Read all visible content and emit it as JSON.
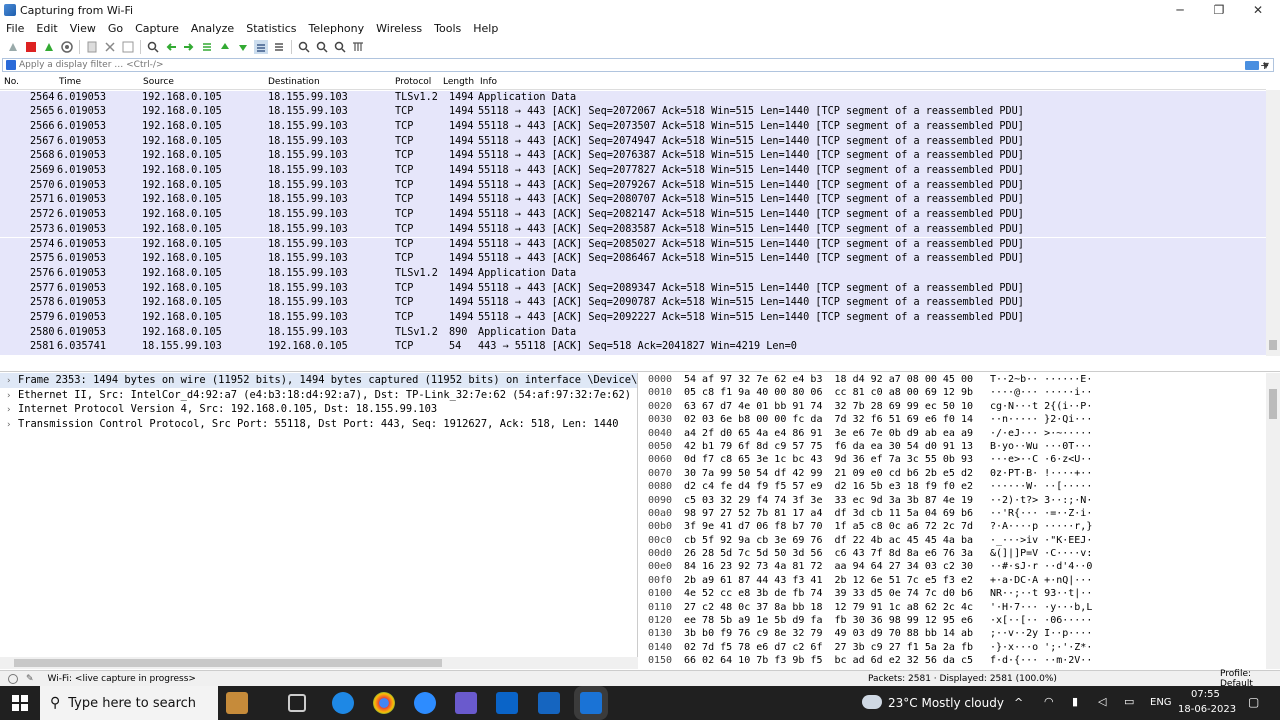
{
  "window": {
    "title": "Capturing from Wi-Fi",
    "minimize": "─",
    "maximize": "❐",
    "close": "✕"
  },
  "menu": [
    "File",
    "Edit",
    "View",
    "Go",
    "Capture",
    "Analyze",
    "Statistics",
    "Telephony",
    "Wireless",
    "Tools",
    "Help"
  ],
  "filter": {
    "placeholder": "Apply a display filter … <Ctrl-/>"
  },
  "packet_list": {
    "columns": [
      "No.",
      "Time",
      "Source",
      "Destination",
      "Protocol",
      "Length",
      "Info"
    ],
    "rows": [
      {
        "no": "2564",
        "time": "6.019053",
        "src": "192.168.0.105",
        "dst": "18.155.99.103",
        "proto": "TLSv1.2",
        "len": "1494",
        "info": "Application Data"
      },
      {
        "no": "2565",
        "time": "6.019053",
        "src": "192.168.0.105",
        "dst": "18.155.99.103",
        "proto": "TCP",
        "len": "1494",
        "info": "55118 → 443 [ACK] Seq=2072067 Ack=518 Win=515 Len=1440 [TCP segment of a reassembled PDU]"
      },
      {
        "no": "2566",
        "time": "6.019053",
        "src": "192.168.0.105",
        "dst": "18.155.99.103",
        "proto": "TCP",
        "len": "1494",
        "info": "55118 → 443 [ACK] Seq=2073507 Ack=518 Win=515 Len=1440 [TCP segment of a reassembled PDU]"
      },
      {
        "no": "2567",
        "time": "6.019053",
        "src": "192.168.0.105",
        "dst": "18.155.99.103",
        "proto": "TCP",
        "len": "1494",
        "info": "55118 → 443 [ACK] Seq=2074947 Ack=518 Win=515 Len=1440 [TCP segment of a reassembled PDU]"
      },
      {
        "no": "2568",
        "time": "6.019053",
        "src": "192.168.0.105",
        "dst": "18.155.99.103",
        "proto": "TCP",
        "len": "1494",
        "info": "55118 → 443 [ACK] Seq=2076387 Ack=518 Win=515 Len=1440 [TCP segment of a reassembled PDU]"
      },
      {
        "no": "2569",
        "time": "6.019053",
        "src": "192.168.0.105",
        "dst": "18.155.99.103",
        "proto": "TCP",
        "len": "1494",
        "info": "55118 → 443 [ACK] Seq=2077827 Ack=518 Win=515 Len=1440 [TCP segment of a reassembled PDU]"
      },
      {
        "no": "2570",
        "time": "6.019053",
        "src": "192.168.0.105",
        "dst": "18.155.99.103",
        "proto": "TCP",
        "len": "1494",
        "info": "55118 → 443 [ACK] Seq=2079267 Ack=518 Win=515 Len=1440 [TCP segment of a reassembled PDU]"
      },
      {
        "no": "2571",
        "time": "6.019053",
        "src": "192.168.0.105",
        "dst": "18.155.99.103",
        "proto": "TCP",
        "len": "1494",
        "info": "55118 → 443 [ACK] Seq=2080707 Ack=518 Win=515 Len=1440 [TCP segment of a reassembled PDU]"
      },
      {
        "no": "2572",
        "time": "6.019053",
        "src": "192.168.0.105",
        "dst": "18.155.99.103",
        "proto": "TCP",
        "len": "1494",
        "info": "55118 → 443 [ACK] Seq=2082147 Ack=518 Win=515 Len=1440 [TCP segment of a reassembled PDU]"
      },
      {
        "no": "2573",
        "time": "6.019053",
        "src": "192.168.0.105",
        "dst": "18.155.99.103",
        "proto": "TCP",
        "len": "1494",
        "info": "55118 → 443 [ACK] Seq=2083587 Ack=518 Win=515 Len=1440 [TCP segment of a reassembled PDU]"
      },
      {
        "no": "2574",
        "time": "6.019053",
        "src": "192.168.0.105",
        "dst": "18.155.99.103",
        "proto": "TCP",
        "len": "1494",
        "info": "55118 → 443 [ACK] Seq=2085027 Ack=518 Win=515 Len=1440 [TCP segment of a reassembled PDU]"
      },
      {
        "no": "2575",
        "time": "6.019053",
        "src": "192.168.0.105",
        "dst": "18.155.99.103",
        "proto": "TCP",
        "len": "1494",
        "info": "55118 → 443 [ACK] Seq=2086467 Ack=518 Win=515 Len=1440 [TCP segment of a reassembled PDU]"
      },
      {
        "no": "2576",
        "time": "6.019053",
        "src": "192.168.0.105",
        "dst": "18.155.99.103",
        "proto": "TLSv1.2",
        "len": "1494",
        "info": "Application Data"
      },
      {
        "no": "2577",
        "time": "6.019053",
        "src": "192.168.0.105",
        "dst": "18.155.99.103",
        "proto": "TCP",
        "len": "1494",
        "info": "55118 → 443 [ACK] Seq=2089347 Ack=518 Win=515 Len=1440 [TCP segment of a reassembled PDU]"
      },
      {
        "no": "2578",
        "time": "6.019053",
        "src": "192.168.0.105",
        "dst": "18.155.99.103",
        "proto": "TCP",
        "len": "1494",
        "info": "55118 → 443 [ACK] Seq=2090787 Ack=518 Win=515 Len=1440 [TCP segment of a reassembled PDU]"
      },
      {
        "no": "2579",
        "time": "6.019053",
        "src": "192.168.0.105",
        "dst": "18.155.99.103",
        "proto": "TCP",
        "len": "1494",
        "info": "55118 → 443 [ACK] Seq=2092227 Ack=518 Win=515 Len=1440 [TCP segment of a reassembled PDU]"
      },
      {
        "no": "2580",
        "time": "6.019053",
        "src": "192.168.0.105",
        "dst": "18.155.99.103",
        "proto": "TLSv1.2",
        "len": "890",
        "info": "Application Data"
      },
      {
        "no": "2581",
        "time": "6.035741",
        "src": "18.155.99.103",
        "dst": "192.168.0.105",
        "proto": "TCP",
        "len": "54",
        "info": "443 → 55118 [ACK] Seq=518 Ack=2041827 Win=4219 Len=0"
      }
    ]
  },
  "details": [
    "Frame 2353: 1494 bytes on wire (11952 bits), 1494 bytes captured (11952 bits) on interface \\Device\\NPF_",
    "Ethernet II, Src: IntelCor_d4:92:a7 (e4:b3:18:d4:92:a7), Dst: TP-Link_32:7e:62 (54:af:97:32:7e:62)",
    "Internet Protocol Version 4, Src: 192.168.0.105, Dst: 18.155.99.103",
    "Transmission Control Protocol, Src Port: 55118, Dst Port: 443, Seq: 1912627, Ack: 518, Len: 1440"
  ],
  "hex": [
    {
      "off": "0000",
      "bytes": "54 af 97 32 7e 62 e4 b3  18 d4 92 a7 08 00 45 00",
      "ascii": "T··2~b·· ······E·"
    },
    {
      "off": "0010",
      "bytes": "05 c8 f1 9a 40 00 80 06  cc 81 c0 a8 00 69 12 9b",
      "ascii": "····@··· ·····i··"
    },
    {
      "off": "0020",
      "bytes": "63 67 d7 4e 01 bb 91 74  32 7b 28 69 99 ec 50 10",
      "ascii": "cg·N···t 2{(i··P·"
    },
    {
      "off": "0030",
      "bytes": "02 03 6e b8 00 00 fc da  7d 32 f6 51 69 e6 f0 14",
      "ascii": "··n····· }2·Qi···"
    },
    {
      "off": "0040",
      "bytes": "a4 2f d0 65 4a e4 86 91  3e e6 7e 0b d9 ab ea a9",
      "ascii": "·/·eJ··· >·~·····"
    },
    {
      "off": "0050",
      "bytes": "42 b1 79 6f 8d c9 57 75  f6 da ea 30 54 d0 91 13",
      "ascii": "B·yo··Wu ···0T···"
    },
    {
      "off": "0060",
      "bytes": "0d f7 c8 65 3e 1c bc 43  9d 36 ef 7a 3c 55 0b 93",
      "ascii": "···e>··C ·6·z<U··"
    },
    {
      "off": "0070",
      "bytes": "30 7a 99 50 54 df 42 99  21 09 e0 cd b6 2b e5 d2",
      "ascii": "0z·PT·B· !····+··"
    },
    {
      "off": "0080",
      "bytes": "d2 c4 fe d4 f9 f5 57 e9  d2 16 5b e3 18 f9 f0 e2",
      "ascii": "······W· ··[·····"
    },
    {
      "off": "0090",
      "bytes": "c5 03 32 29 f4 74 3f 3e  33 ec 9d 3a 3b 87 4e 19",
      "ascii": "··2)·t?> 3··:;·N·"
    },
    {
      "off": "00a0",
      "bytes": "98 97 27 52 7b 81 17 a4  df 3d cb 11 5a 04 69 b6",
      "ascii": "··'R{··· ·=··Z·i·"
    },
    {
      "off": "00b0",
      "bytes": "3f 9e 41 d7 06 f8 b7 70  1f a5 c8 0c a6 72 2c 7d",
      "ascii": "?·A····p ·····r,}"
    },
    {
      "off": "00c0",
      "bytes": "cb 5f 92 9a cb 3e 69 76  df 22 4b ac 45 45 4a ba",
      "ascii": "·_···>iv ·\"K·EEJ·"
    },
    {
      "off": "00d0",
      "bytes": "26 28 5d 7c 5d 50 3d 56  c6 43 7f 8d 8a e6 76 3a",
      "ascii": "&(]|]P=V ·C····v:"
    },
    {
      "off": "00e0",
      "bytes": "84 16 23 92 73 4a 81 72  aa 94 64 27 34 03 c2 30",
      "ascii": "··#·sJ·r ··d'4··0"
    },
    {
      "off": "00f0",
      "bytes": "2b a9 61 87 44 43 f3 41  2b 12 6e 51 7c e5 f3 e2",
      "ascii": "+·a·DC·A +·nQ|···"
    },
    {
      "off": "0100",
      "bytes": "4e 52 cc e8 3b de fb 74  39 33 d5 0e 74 7c d0 b6",
      "ascii": "NR··;··t 93··t|··"
    },
    {
      "off": "0110",
      "bytes": "27 c2 48 0c 37 8a bb 18  12 79 91 1c a8 62 2c 4c",
      "ascii": "'·H·7··· ·y···b,L"
    },
    {
      "off": "0120",
      "bytes": "ee 78 5b a9 1e 5b d9 fa  fb 30 36 98 99 12 95 e6",
      "ascii": "·x[··[·· ·06·····"
    },
    {
      "off": "0130",
      "bytes": "3b b0 f9 76 c9 8e 32 79  49 03 d9 70 88 bb 14 ab",
      "ascii": ";··v··2y I··p····"
    },
    {
      "off": "0140",
      "bytes": "02 7d f5 78 e6 d7 c2 6f  27 3b c9 27 f1 5a 2a fb",
      "ascii": "·}·x···o ';·'·Z*·"
    },
    {
      "off": "0150",
      "bytes": "66 02 64 10 7b f3 9b f5  bc ad 6d e2 32 56 da c5",
      "ascii": "f·d·{··· ··m·2V··"
    }
  ],
  "status": {
    "interface": "Wi-Fi: <live capture in progress>",
    "packets": "Packets: 2581 · Displayed: 2581 (100.0%)",
    "profile": "Profile: Default"
  },
  "taskbar": {
    "search": "Type here to search",
    "weather": "23°C  Mostly cloudy",
    "lang": "ENG",
    "time": "07:55",
    "date": "18-06-2023"
  }
}
